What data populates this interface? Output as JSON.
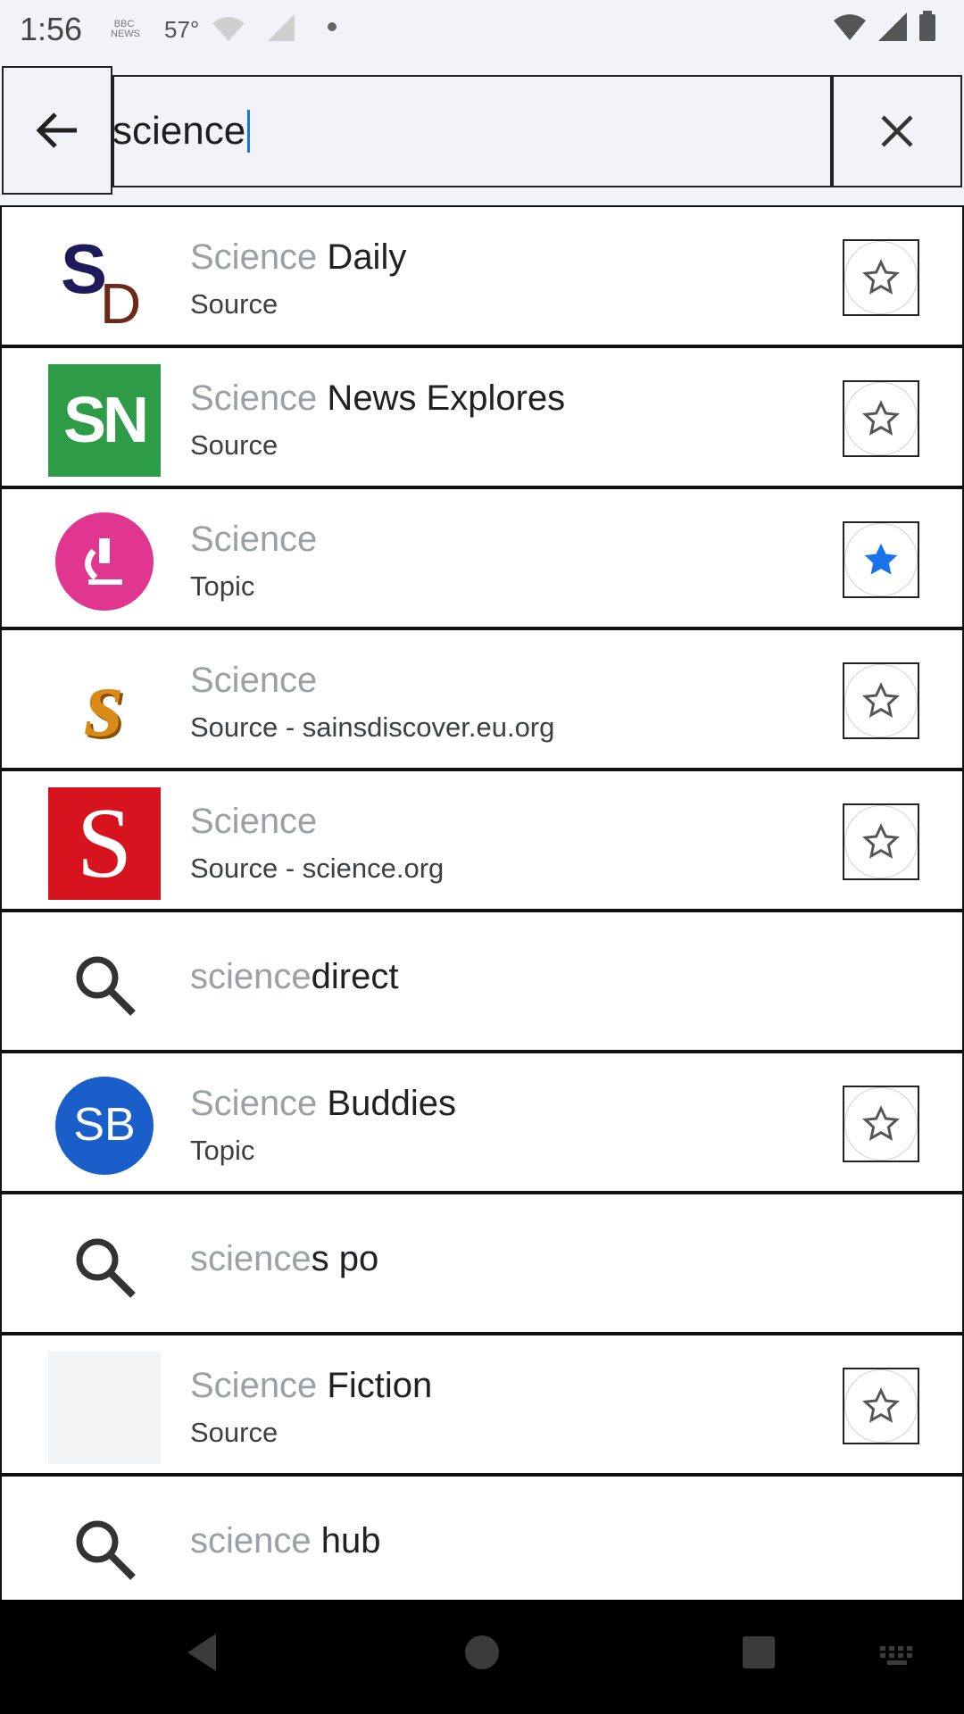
{
  "status_bar": {
    "time": "1:56",
    "news_icon_label": "BBC NEWS",
    "temperature": "57°"
  },
  "search": {
    "query": "science"
  },
  "results": [
    {
      "kind": "entity",
      "logo": "SD",
      "query_part": "Science",
      "rest": " Daily",
      "subtitle": "Source",
      "starred": false
    },
    {
      "kind": "entity",
      "logo": "SN",
      "query_part": "Science",
      "rest": " News Explores",
      "subtitle": "Source",
      "starred": false
    },
    {
      "kind": "entity",
      "logo": "topic-science",
      "query_part": "Science",
      "rest": "",
      "subtitle": "Topic",
      "starred": true
    },
    {
      "kind": "entity",
      "logo": "S-orange",
      "query_part": "Science",
      "rest": "",
      "subtitle": "Source - sainsdiscover.eu.org",
      "starred": false
    },
    {
      "kind": "entity",
      "logo": "S-red",
      "query_part": "Science",
      "rest": "",
      "subtitle": "Source - science.org",
      "starred": false
    },
    {
      "kind": "query",
      "query_part": "science",
      "rest": "direct"
    },
    {
      "kind": "entity",
      "logo": "SB",
      "query_part": "Science",
      "rest": " Buddies",
      "subtitle": "Topic",
      "starred": false
    },
    {
      "kind": "query",
      "query_part": "science",
      "rest": "s po"
    },
    {
      "kind": "entity",
      "logo": "blank",
      "query_part": "Science",
      "rest": " Fiction",
      "subtitle": "Source",
      "starred": false
    },
    {
      "kind": "query",
      "query_part": "science",
      "rest": " hub"
    }
  ],
  "colors": {
    "star_active": "#1a73e8",
    "query_gray": "#9aa0a6",
    "sn_green": "#2e9b47",
    "topic_pink": "#e0368f",
    "sb_blue": "#1a5fc9",
    "science_red": "#d7141d",
    "orange_s": "#d98a17"
  }
}
